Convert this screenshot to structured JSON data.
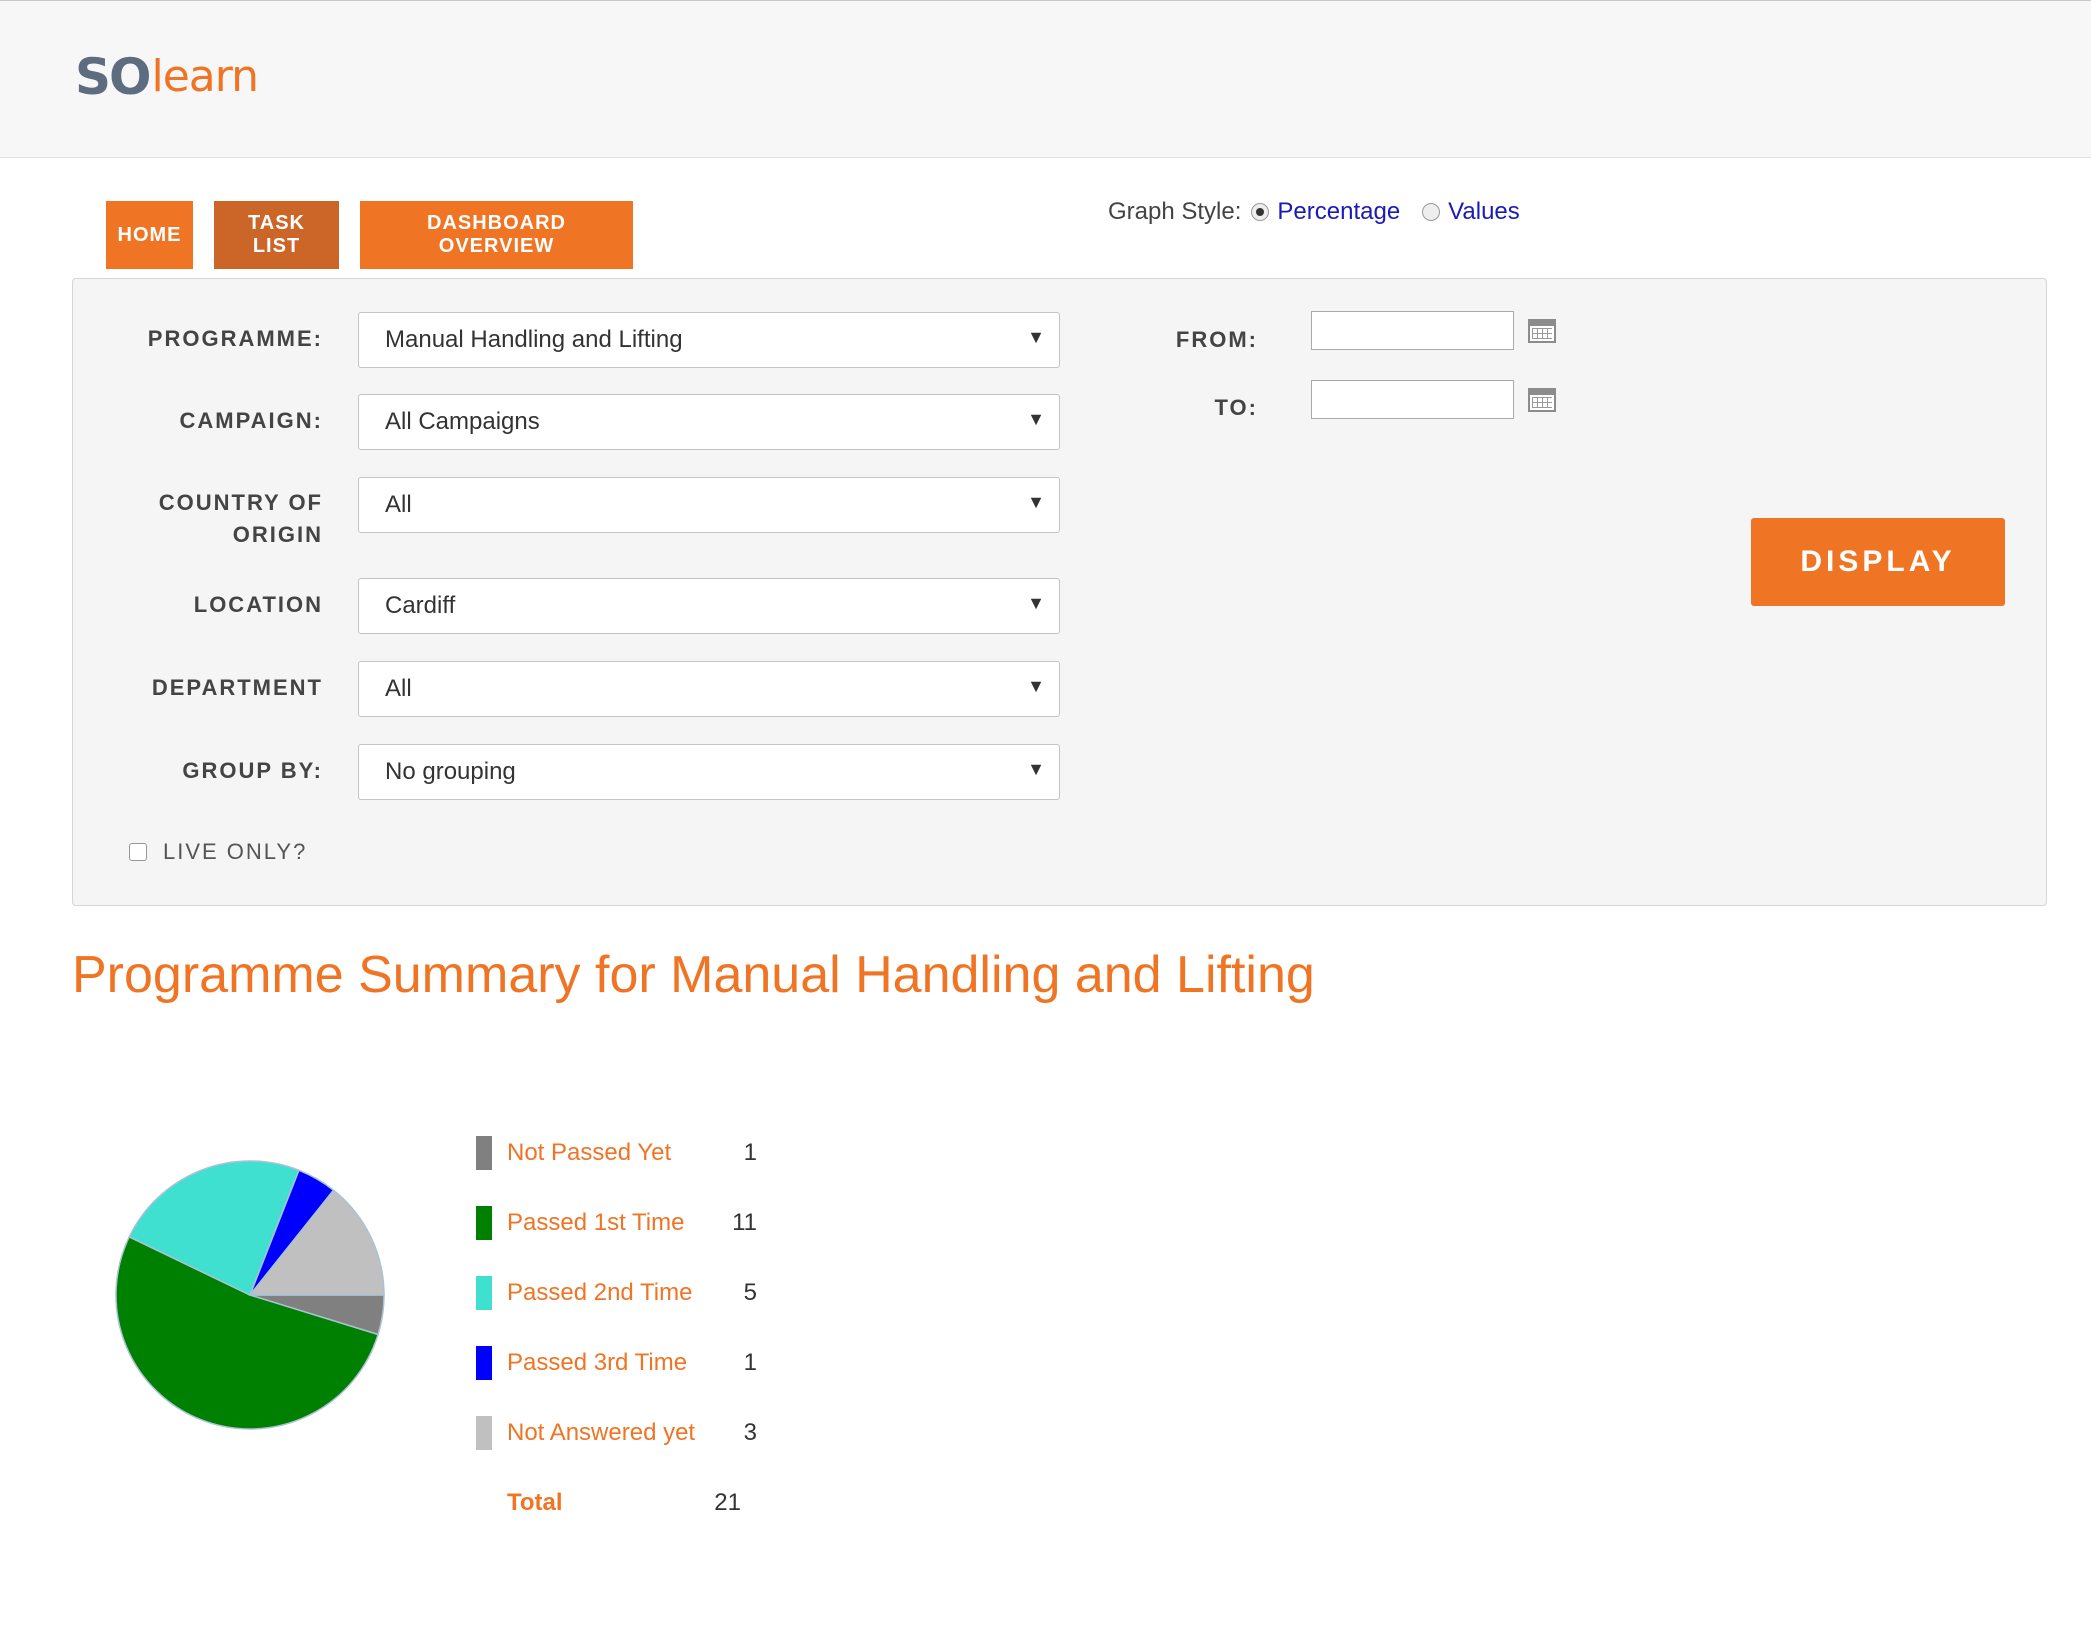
{
  "brand": {
    "logo_part1": "SO",
    "logo_part2": "learn"
  },
  "nav": [
    {
      "label": "HOME"
    },
    {
      "label": "TASK LIST"
    },
    {
      "label": "DASHBOARD OVERVIEW"
    }
  ],
  "graph_style": {
    "label": "Graph Style:",
    "option_percentage": "Percentage",
    "option_values": "Values",
    "selected": "Percentage"
  },
  "filters": {
    "programme": {
      "label": "PROGRAMME:",
      "value": "Manual Handling and Lifting"
    },
    "campaign": {
      "label": "CAMPAIGN:",
      "value": "All Campaigns"
    },
    "country_line1": "COUNTRY OF",
    "country_line2": "ORIGIN",
    "country_value": "All",
    "location": {
      "label": "LOCATION",
      "value": "Cardiff"
    },
    "department": {
      "label": "DEPARTMENT",
      "value": "All"
    },
    "group_by": {
      "label": "GROUP BY:",
      "value": "No grouping"
    },
    "from_label": "FROM:",
    "to_label": "TO:",
    "from_value": "",
    "to_value": "",
    "live_only_label": "LIVE ONLY?",
    "live_only_checked": false,
    "display_label": "DISPLAY"
  },
  "summary": {
    "title": "Programme Summary for Manual Handling and Lifting"
  },
  "chart_data": {
    "type": "pie",
    "categories": [
      "Not Passed Yet",
      "Passed 1st Time",
      "Passed 2nd Time",
      "Passed 3rd Time",
      "Not Answered yet"
    ],
    "values": [
      1,
      11,
      5,
      1,
      3
    ],
    "colors": [
      "#808080",
      "#008000",
      "#40e0d0",
      "#0000ff",
      "#c0c0c0"
    ],
    "total_label": "Total",
    "total": 21
  }
}
